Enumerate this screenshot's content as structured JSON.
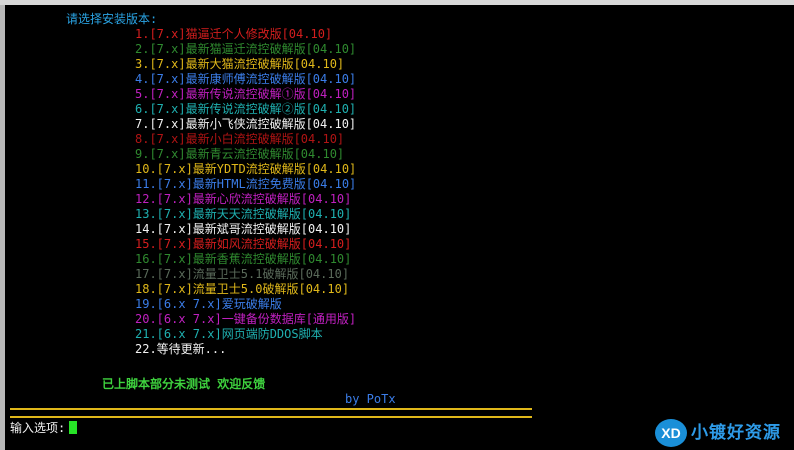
{
  "terminal": {
    "prompt_title": "请选择安装版本:",
    "menu": [
      {
        "text": "1.[7.x]猫逼迁个人修改版[04.10]",
        "color": "red"
      },
      {
        "text": "2.[7.x]最新猫逼迁流控破解版[04.10]",
        "color": "dkgreen"
      },
      {
        "text": "3.[7.x]最新大猫流控破解版[04.10]",
        "color": "yellow"
      },
      {
        "text": "4.[7.x]最新康师傅流控破解版[04.10]",
        "color": "blue"
      },
      {
        "text": "5.[7.x]最新传说流控破解①版[04.10]",
        "color": "magenta"
      },
      {
        "text": "6.[7.x]最新传说流控破解②版[04.10]",
        "color": "cyan"
      },
      {
        "text": "7.[7.x]最新小飞侠流控破解版[04.10]",
        "color": "white"
      },
      {
        "text": "8.[7.x]最新小白流控破解版[04.10]",
        "color": "dkred"
      },
      {
        "text": "9.[7.x]最新青云流控破解版[04.10]",
        "color": "dkgreen"
      },
      {
        "text": "10.[7.x]最新YDTD流控破解版[04.10]",
        "color": "yellow"
      },
      {
        "text": "11.[7.x]最新HTML流控免费版[04.10]",
        "color": "blue"
      },
      {
        "text": "12.[7.x]最新心欣流控破解版[04.10]",
        "color": "magenta"
      },
      {
        "text": "13.[7.x]最新天天流控破解版[04.10]",
        "color": "cyan"
      },
      {
        "text": "14.[7.x]最新斌哥流控破解版[04.10]",
        "color": "white"
      },
      {
        "text": "15.[7.x]最新如风流控破解版[04.10]",
        "color": "red"
      },
      {
        "text": "16.[7.x]最新香蕉流控破解版[04.10]",
        "color": "dkgreen"
      },
      {
        "text": "17.[7.x]流量卫士5.1破解版[04.10]",
        "color": "gray"
      },
      {
        "text": "18.[7.x]流量卫士5.0破解版[04.10]",
        "color": "yellow"
      },
      {
        "text": "19.[6.x 7.x]爱玩破解版",
        "color": "blue"
      },
      {
        "text": "20.[6.x 7.x]一键备份数据库[通用版]",
        "color": "magenta"
      },
      {
        "text": "21.[6.x 7.x]网页端防DDOS脚本",
        "color": "cyan"
      },
      {
        "text": "22.等待更新...",
        "color": "white"
      }
    ],
    "notice": "已上脚本部分未测试 欢迎反馈",
    "author": "by PoTx",
    "input_label": "输入选项:"
  },
  "watermark": {
    "logo_text": "XD",
    "site_name": "小镀好资源"
  },
  "colors": {
    "background": "#000000",
    "title": "#2aa3e3",
    "notice": "#3ed23e",
    "cursor": "#27e327",
    "divider": "#e0b81a"
  }
}
